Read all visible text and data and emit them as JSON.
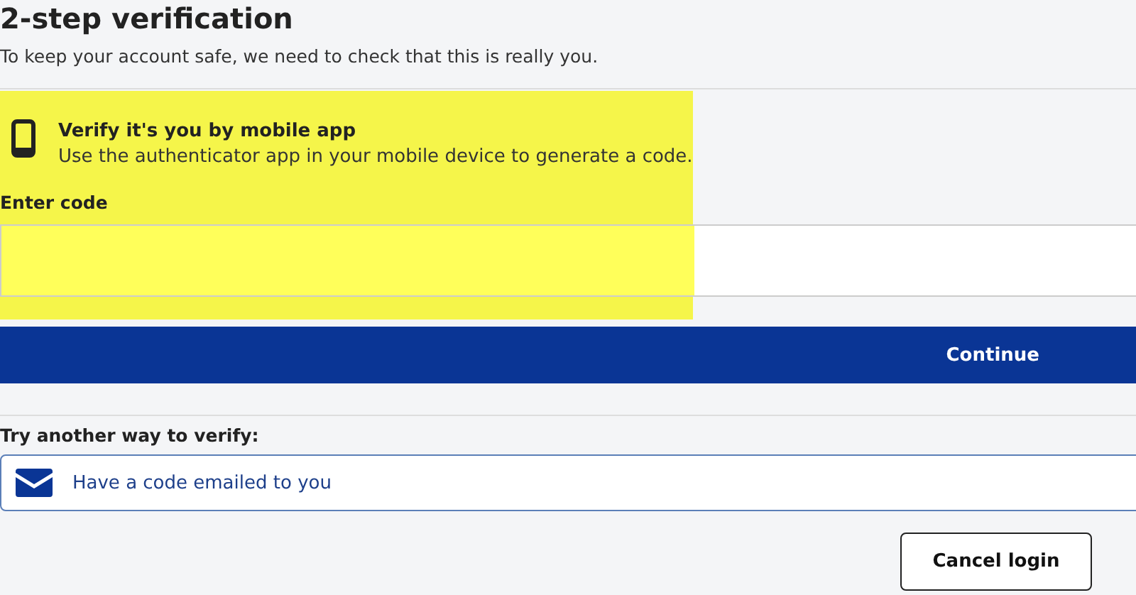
{
  "title": "2-step verification",
  "subtitle": "To keep your account safe, we need to check that this is really you.",
  "method": {
    "title": "Verify it's you by mobile app",
    "description": "Use the authenticator app in your mobile device to generate a code."
  },
  "code_field": {
    "label": "Enter code"
  },
  "continue_button": "Continue",
  "alternatives": {
    "heading": "Try another way to verify:",
    "options": [
      {
        "kind": "email",
        "label": "Have a code emailed to you"
      }
    ]
  },
  "cancel_button": "Cancel login"
}
